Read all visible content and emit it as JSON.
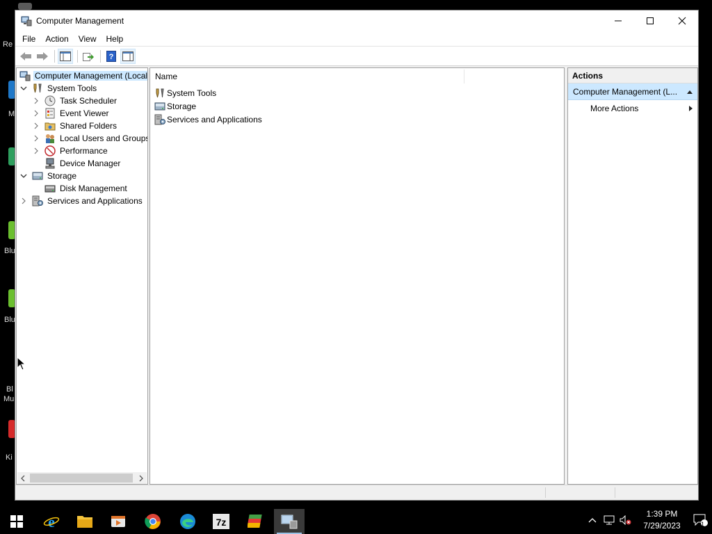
{
  "window": {
    "title": "Computer Management"
  },
  "menu": [
    "File",
    "Action",
    "View",
    "Help"
  ],
  "tree": {
    "root": "Computer Management (Local",
    "system_tools": "System Tools",
    "task_scheduler": "Task Scheduler",
    "event_viewer": "Event Viewer",
    "shared_folders": "Shared Folders",
    "local_users": "Local Users and Groups",
    "performance": "Performance",
    "device_manager": "Device Manager",
    "storage": "Storage",
    "disk_management": "Disk Management",
    "services": "Services and Applications"
  },
  "list": {
    "column": "Name",
    "items": [
      "System Tools",
      "Storage",
      "Services and Applications"
    ]
  },
  "actions": {
    "title": "Actions",
    "group": "Computer Management (L...",
    "more": "More Actions"
  },
  "taskbar": {
    "time": "1:39 PM",
    "date": "7/29/2023",
    "notifications": "1"
  },
  "desktop_labels": [
    "Re",
    "M",
    "Blu",
    "Blu",
    "Bl",
    "Mu",
    "Ki"
  ]
}
